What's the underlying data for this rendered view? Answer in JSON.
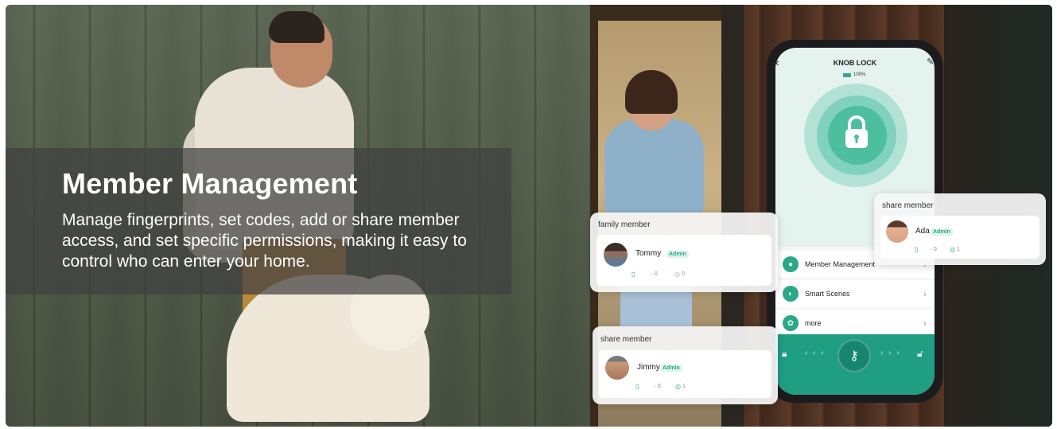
{
  "hero": {
    "title": "Member Management",
    "description": "Manage fingerprints, set codes, add or share member access, and set specific permissions, making it easy to control who can enter your home."
  },
  "phone": {
    "back_icon": "back-arrow-icon",
    "edit_icon": "edit-icon",
    "lock_name": "KNOB LOCK",
    "battery": "100%",
    "menu": [
      {
        "label": "Member Management",
        "icon": "person-icon"
      },
      {
        "label": "Smart Scenes",
        "icon": "toggle-icon"
      },
      {
        "label": "more",
        "icon": "gear-icon"
      }
    ],
    "bottom_bar": {
      "left_icon": "lock-icon",
      "right_icon": "unlock-icon",
      "center_icon": "key-icon",
      "left_arrows": "‹ ‹ ‹",
      "right_arrows": "› › ›"
    }
  },
  "cards": {
    "family": {
      "title": "family member",
      "name": "Tommy",
      "badge": "Admin",
      "stat1": "0",
      "stat2": "0"
    },
    "share_top": {
      "title": "share member",
      "name": "Ada",
      "badge": "Admin",
      "stat1": "0",
      "stat2": "1"
    },
    "share_bottom": {
      "title": "share member",
      "name": "Jimmy",
      "badge": "Admin",
      "stat1": "0",
      "stat2": "1"
    }
  },
  "colors": {
    "accent": "#2ba789",
    "bottom_bar": "#1f9e82",
    "overlay": "#404040"
  }
}
